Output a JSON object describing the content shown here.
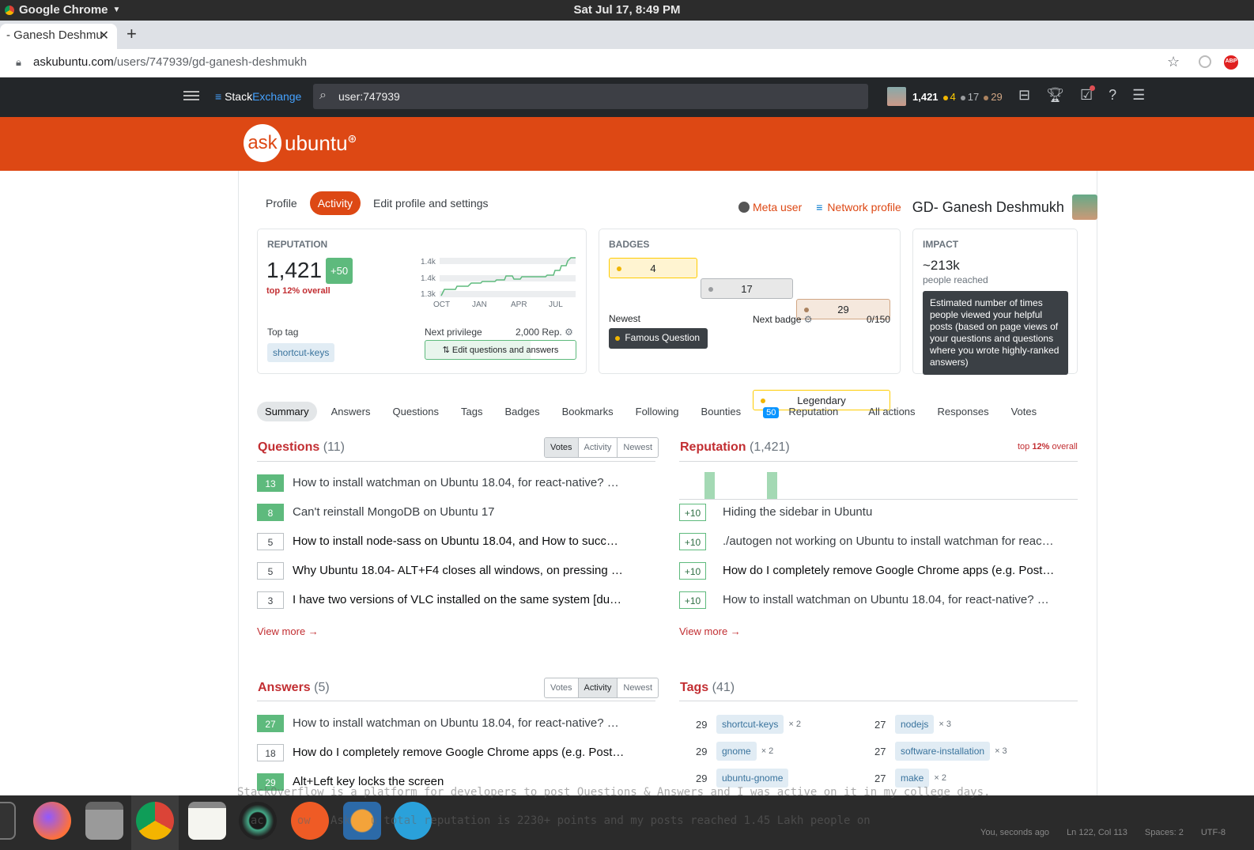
{
  "system": {
    "app_menu": "Google Chrome",
    "clock": "Sat Jul 17,  8:49 PM"
  },
  "browser": {
    "tab_title": "- Ganesh Deshmu",
    "url_host": "askubuntu.com",
    "url_path": "/users/747939/gd-ganesh-deshmukh",
    "abp_label": "ABP"
  },
  "se_top": {
    "brand_a": "Stack",
    "brand_b": "Exchange",
    "search_value": "user:747939",
    "rep": "1,421",
    "gold": "4",
    "silver": "17",
    "bronze": "29"
  },
  "site": {
    "ask": "ask",
    "ubuntu": "ubuntu"
  },
  "profile_nav": {
    "tabs": [
      "Profile",
      "Activity",
      "Edit profile and settings"
    ],
    "active": "Activity"
  },
  "header": {
    "meta": "Meta user",
    "network": "Network profile",
    "name": "GD- Ganesh Deshmukh"
  },
  "reputation_card": {
    "label": "REPUTATION",
    "value": "1,421",
    "delta": "+50",
    "rank": "top 12% overall",
    "chart_y": [
      "1.4k",
      "1.4k",
      "1.3k"
    ],
    "chart_x": [
      "OCT",
      "JAN",
      "APR",
      "JUL"
    ],
    "top_tag_label": "Top tag",
    "top_tag": "shortcut-keys",
    "next_priv_label": "Next privilege",
    "next_priv_rep": "2,000 Rep.",
    "next_priv_button": "Edit questions and answers"
  },
  "badges_card": {
    "label": "BADGES",
    "gold": "4",
    "silver": "17",
    "bronze": "29",
    "newest_label": "Newest",
    "newest": "Famous Question",
    "next_label": "Next badge",
    "next_progress": "0/150",
    "next": "Legendary"
  },
  "impact_card": {
    "label": "IMPACT",
    "value": "~213k",
    "sub": "people reached",
    "tooltip": "Estimated number of times people viewed your helpful posts (based on page views of your questions and questions where you wrote highly-ranked answers)"
  },
  "subtabs": [
    "Summary",
    "Answers",
    "Questions",
    "Tags",
    "Badges",
    "Bookmarks",
    "Following",
    "Bounties",
    "Reputation",
    "All actions",
    "Responses",
    "Votes"
  ],
  "rep_tab_badge": "50",
  "questions": {
    "title": "Questions",
    "count": "(11)",
    "sort": [
      "Votes",
      "Activity",
      "Newest"
    ],
    "items": [
      {
        "score": "13",
        "title": "How to install watchman on Ubuntu 18.04, for react-native? e…",
        "accepted": true
      },
      {
        "score": "8",
        "title": "Can't reinstall MongoDB on Ubuntu 17",
        "accepted": true
      },
      {
        "score": "5",
        "title": "How to install node-sass on Ubuntu 18.04, and How to succe…",
        "accepted": false
      },
      {
        "score": "5",
        "title": "Why Ubuntu 18.04- ALT+F4 closes all windows, on pressing …",
        "accepted": false
      },
      {
        "score": "3",
        "title": "I have two versions of VLC installed on the same system [dup…",
        "accepted": false
      }
    ],
    "view_more": "View more →"
  },
  "reputation_list": {
    "title": "Reputation",
    "count": "(1,421)",
    "rank_pre": "top ",
    "rank_pct": "12%",
    "rank_post": " overall",
    "items": [
      {
        "delta": "+10",
        "title": "Hiding the sidebar in Ubuntu"
      },
      {
        "delta": "+10",
        "title": "./autogen not working on Ubuntu to install watchman for react…"
      },
      {
        "delta": "+10",
        "title": "How do I completely remove Google Chrome apps (e.g. Post…"
      },
      {
        "delta": "+10",
        "title": "How to install watchman on Ubuntu 18.04, for react-native? e…"
      }
    ],
    "view_more": "View more →"
  },
  "answers": {
    "title": "Answers",
    "count": "(5)",
    "sort": [
      "Votes",
      "Activity",
      "Newest"
    ],
    "items": [
      {
        "score": "27",
        "title": "How to install watchman on Ubuntu 18.04, for react-native? e…",
        "accepted": true
      },
      {
        "score": "18",
        "title": "How do I completely remove Google Chrome apps (e.g. Post…",
        "accepted": false
      },
      {
        "score": "29",
        "title": "Alt+Left key locks the screen",
        "accepted": true
      }
    ]
  },
  "tags": {
    "title": "Tags",
    "count": "(41)",
    "left": [
      {
        "n": "29",
        "tag": "shortcut-keys",
        "x": "× 2"
      },
      {
        "n": "29",
        "tag": "gnome",
        "x": "× 2"
      },
      {
        "n": "29",
        "tag": "ubuntu-gnome",
        "x": ""
      }
    ],
    "right": [
      {
        "n": "27",
        "tag": "nodejs",
        "x": "× 3"
      },
      {
        "n": "27",
        "tag": "software-installation",
        "x": "× 3"
      },
      {
        "n": "27",
        "tag": "make",
        "x": "× 2"
      }
    ]
  },
  "behind_text": {
    "line1": "StackOverflow is a platform for developers to post Questions & Answers and I was active on it in my college days.",
    "line2": "  ac     ow   Ask   u total reputation is 2230+ points and my posts reached 1.45 Lakh people on"
  },
  "editor_status": {
    "git": "You, seconds ago",
    "pos": "Ln 122, Col 113",
    "spaces": "Spaces: 2",
    "enc": "UTF-8"
  },
  "colors": {
    "accent": "#dd4814",
    "topbar": "#232629",
    "green": "#5eba7d"
  }
}
